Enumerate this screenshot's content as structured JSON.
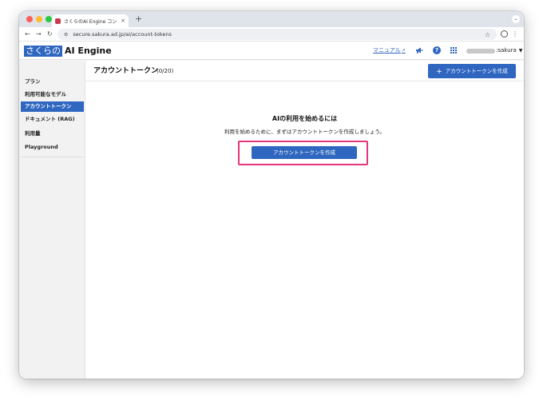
{
  "browser": {
    "tab_title": "さくらのAI Engine コントロ…",
    "tab_close": "×",
    "new_tab": "+",
    "url": "secure.sakura.ad.jp/ai/account-tokens"
  },
  "header": {
    "logo_box": "さくらの",
    "logo_text": "AI Engine",
    "manual_label": "マニュアル",
    "user_name": ":sakura"
  },
  "sidebar": {
    "items": [
      {
        "label": "プラン"
      },
      {
        "label": "利用可能なモデル"
      },
      {
        "label": "アカウントトークン"
      },
      {
        "label": "ドキュメント (RAG)"
      },
      {
        "label": "利用量"
      },
      {
        "label": "Playground"
      }
    ]
  },
  "main": {
    "title": "アカウントトークン",
    "count": "(0/20)",
    "create_button_label": "アカウントトークンを作成",
    "empty_title": "AIの利用を始めるには",
    "empty_description": "利用を始めるために、まずはアカウントトークンを作成しましょう。",
    "cta_label": "アカウントトークンを作成"
  },
  "colors": {
    "accent": "#2f66c0",
    "highlight": "#e5357b"
  },
  "icons": [
    "site-info-icon",
    "star-icon",
    "profile-icon",
    "external-link-icon",
    "megaphone-icon",
    "help-icon",
    "apps-icon",
    "plus-icon"
  ]
}
